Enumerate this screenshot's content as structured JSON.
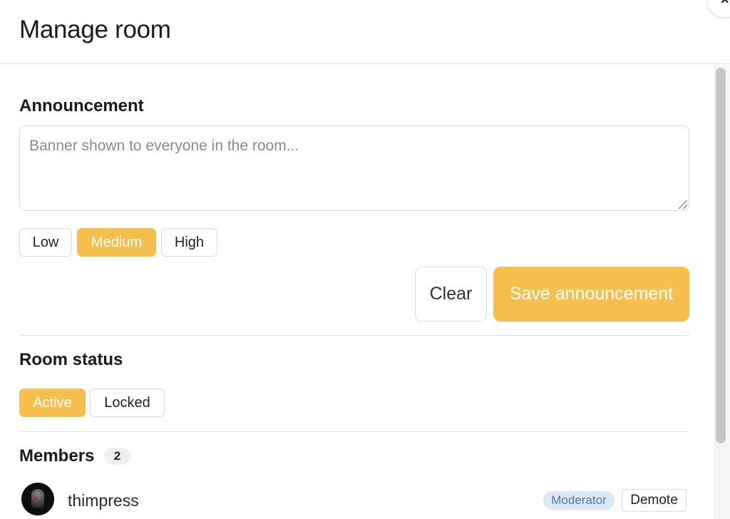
{
  "modal": {
    "title": "Manage room",
    "close_label": "×"
  },
  "announcement": {
    "heading": "Announcement",
    "placeholder": "Banner shown to everyone in the room...",
    "value": "",
    "priorities": [
      {
        "label": "Low",
        "active": false
      },
      {
        "label": "Medium",
        "active": true
      },
      {
        "label": "High",
        "active": false
      }
    ],
    "clear_label": "Clear",
    "save_label": "Save announcement"
  },
  "room_status": {
    "heading": "Room status",
    "options": [
      {
        "label": "Active",
        "active": true
      },
      {
        "label": "Locked",
        "active": false
      }
    ]
  },
  "members": {
    "heading": "Members",
    "count": "2",
    "list": [
      {
        "name": "thimpress",
        "role": "Moderator",
        "action_label": "Demote"
      }
    ]
  },
  "colors": {
    "accent": "#f4bf4c",
    "role_badge_bg": "#dce8f6",
    "role_badge_text": "#4b79b0"
  }
}
